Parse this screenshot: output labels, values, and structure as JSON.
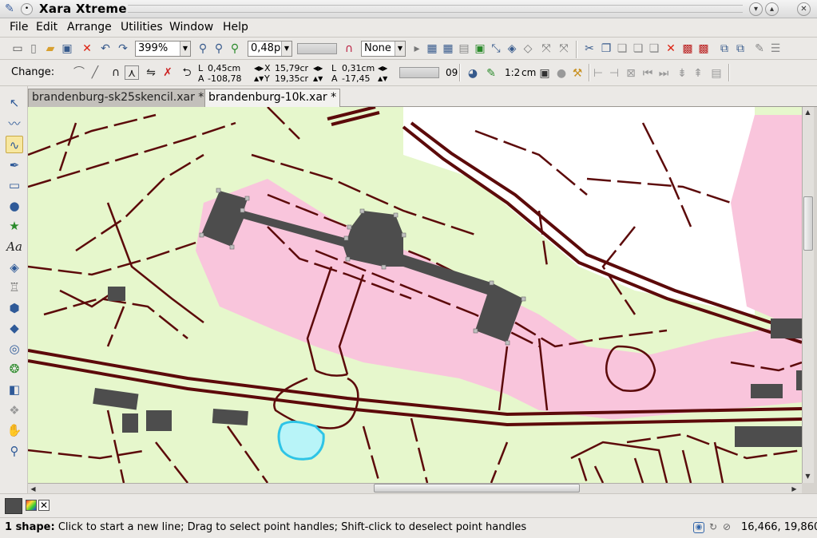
{
  "window": {
    "title": "Xara Xtreme"
  },
  "menu": [
    "File",
    "Edit",
    "Arrange",
    "Utilities",
    "Window",
    "Help"
  ],
  "toolbar": {
    "zoom": "399%",
    "line_width": "0,48p",
    "arrowhead": "None"
  },
  "info_bar": {
    "change_label": "Change:",
    "l_label": "L",
    "a_label": "A",
    "x_label": "X",
    "y_label": "Y",
    "l2_label": "L",
    "a2_label": "A",
    "width": "0,45cm",
    "angle": "-108,78",
    "x": "15,79cr",
    "y": "19,35cr",
    "length2": "0,31cm",
    "angle2": "-17,45",
    "percent": "09",
    "scale": "1:2",
    "unit": "cm"
  },
  "tabs": [
    {
      "label": "brandenburg-sk25skencil.xar *",
      "active": false
    },
    {
      "label": "brandenburg-10k.xar *",
      "active": true
    }
  ],
  "status": {
    "prefix": "1 shape:",
    "message": "Click to start a new line; Drag to select point handles; Shift-click to deselect point handles",
    "coordinates": "16,466, 19,860"
  },
  "colors": {
    "road": "#5c0a0a",
    "park": "#e6f7cc",
    "urban": "#f9c5dc",
    "building": "#4d4d4d",
    "water": "#b8f4f8",
    "water_outline": "#2ec4e6"
  },
  "icons": {
    "tools": [
      "selector-icon",
      "freehand-icon",
      "bezier-icon",
      "pen-icon",
      "rectangle-icon",
      "ellipse-icon",
      "shapes-icon",
      "text-icon",
      "fill-icon",
      "transparency-icon",
      "mould-icon",
      "bevel-icon",
      "contour-icon",
      "shadow-icon",
      "blend-icon",
      "live-effect-icon",
      "push-icon",
      "zoom-icon"
    ]
  }
}
